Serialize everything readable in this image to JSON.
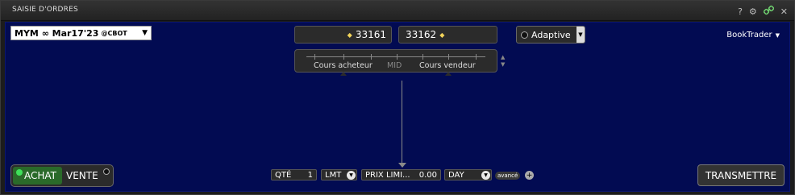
{
  "window": {
    "title": "SAISIE D'ORDRES"
  },
  "titlebar_icons": [
    "help-icon",
    "gear-icon",
    "link-icon",
    "close-icon"
  ],
  "titlebar_glyphs": {
    "help": "?",
    "gear": "⚙",
    "link": "🔗",
    "close": "✕"
  },
  "contract": {
    "symbol": "MYM ∞ Mar17'23",
    "exchange": "@CBOT"
  },
  "quotes": {
    "bid": "33161",
    "ask": "33162"
  },
  "scale": {
    "bid_label": "Cours acheteur",
    "mid_label": "MID",
    "ask_label": "Cours vendeur"
  },
  "algo": {
    "label": "Adaptive"
  },
  "tool": {
    "label": "BookTrader"
  },
  "side": {
    "buy": "ACHAT",
    "sell": "VENTE"
  },
  "order": {
    "qty_label": "QTÉ",
    "qty_value": "1",
    "type": "LMT",
    "price_label": "PRIX LIMI...",
    "price_value": "0.00",
    "tif": "DAY",
    "advanced": "avancé",
    "plus": "+"
  },
  "submit": {
    "label": "TRANSMETTRE"
  },
  "colors": {
    "panel_bg": "#020b52",
    "buy_green": "#2a6a2a",
    "quote_marker": "#f2d45a"
  }
}
